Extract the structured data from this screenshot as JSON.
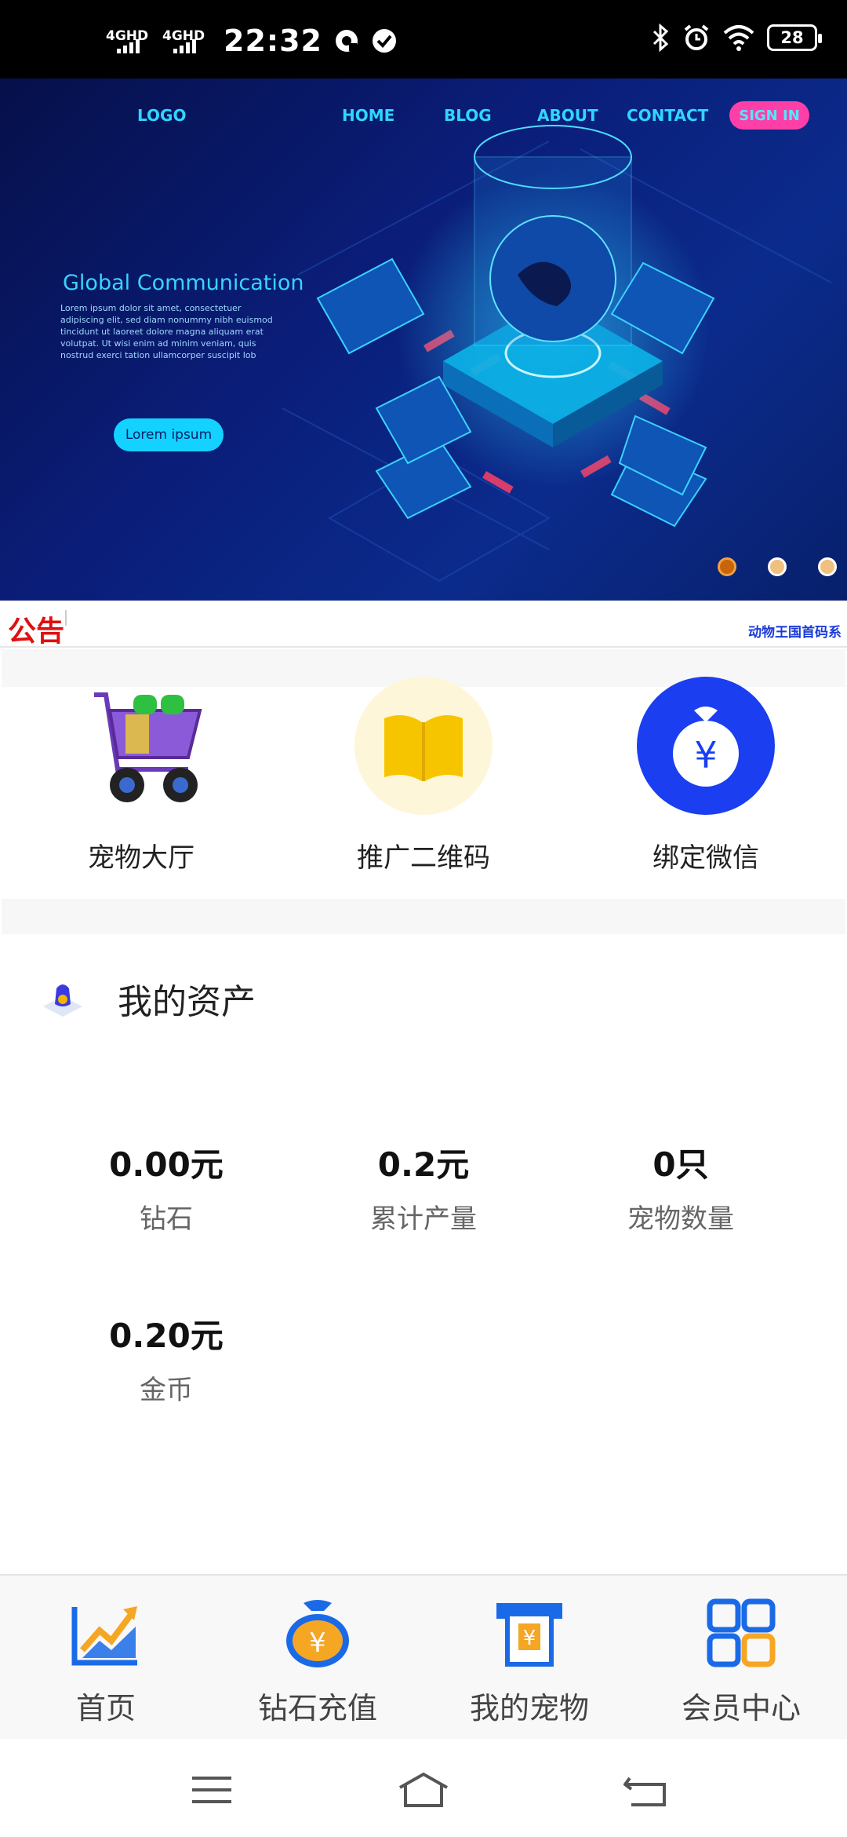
{
  "status_bar": {
    "network_1": "4GHD",
    "network_2": "4GHD",
    "time": "22:32",
    "battery": "28"
  },
  "banner": {
    "logo": "LOGO",
    "nav": [
      "HOME",
      "BLOG",
      "ABOUT",
      "CONTACT"
    ],
    "sign_in": "SIGN IN",
    "title": "Global Communication",
    "body": "Lorem ipsum dolor sit amet, consectetuer adipiscing elit, sed diam nonummy nibh euismod tincidunt ut laoreet dolore magna aliquam erat volutpat. Ut wisi enim ad minim veniam, quis nostrud exerci tation ullamcorper suscipit lob",
    "button": "Lorem ipsum",
    "slide_count": 3,
    "active_slide": 1
  },
  "notice": {
    "label": "公告",
    "text": "动物王国首码系"
  },
  "quick_links": [
    {
      "label": "宠物大厅",
      "icon": "shopping-cart-icon"
    },
    {
      "label": "推广二维码",
      "icon": "book-icon"
    },
    {
      "label": "绑定微信",
      "icon": "money-bag-icon"
    }
  ],
  "assets": {
    "title": "我的资产",
    "items": [
      {
        "value": "0.00元",
        "label": "钻石"
      },
      {
        "value": "0.2元",
        "label": "累计产量"
      },
      {
        "value": "0只",
        "label": "宠物数量"
      },
      {
        "value": "0.20元",
        "label": "金币"
      }
    ]
  },
  "tabbar": {
    "items": [
      {
        "label": "首页",
        "icon": "trend-chart-icon"
      },
      {
        "label": "钻石充值",
        "icon": "money-bag-icon"
      },
      {
        "label": "我的宠物",
        "icon": "atm-card-icon"
      },
      {
        "label": "会员中心",
        "icon": "grid-icon"
      }
    ]
  },
  "colors": {
    "accent_blue": "#1a6ae8",
    "notice_red": "#e01010",
    "banner_cyan": "#2fd6ff",
    "signin_pink": "#ff3fa8"
  }
}
